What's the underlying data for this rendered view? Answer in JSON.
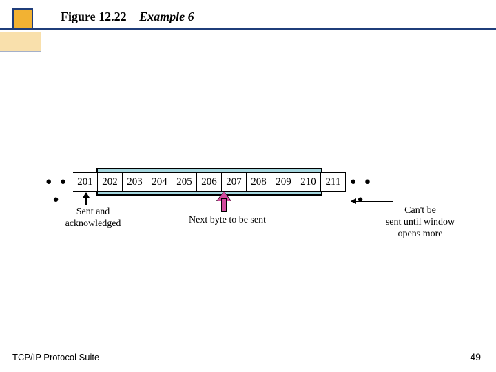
{
  "title": {
    "figure": "Figure 12.22",
    "example": "Example 6"
  },
  "footer": {
    "left": "TCP/IP Protocol Suite",
    "right": "49"
  },
  "bytes": {
    "left_dots": "● ● ●",
    "right_dots": "● ● ●",
    "cells": [
      "201",
      "202",
      "203",
      "204",
      "205",
      "206",
      "207",
      "208",
      "209",
      "210",
      "211"
    ],
    "window_start_index": 1,
    "window_end_index": 9
  },
  "labels": {
    "sent_ack": "Sent and\nacknowledged",
    "next_byte": "Next byte to be sent",
    "cant_send": "Can't be\nsent until window\nopens more"
  }
}
